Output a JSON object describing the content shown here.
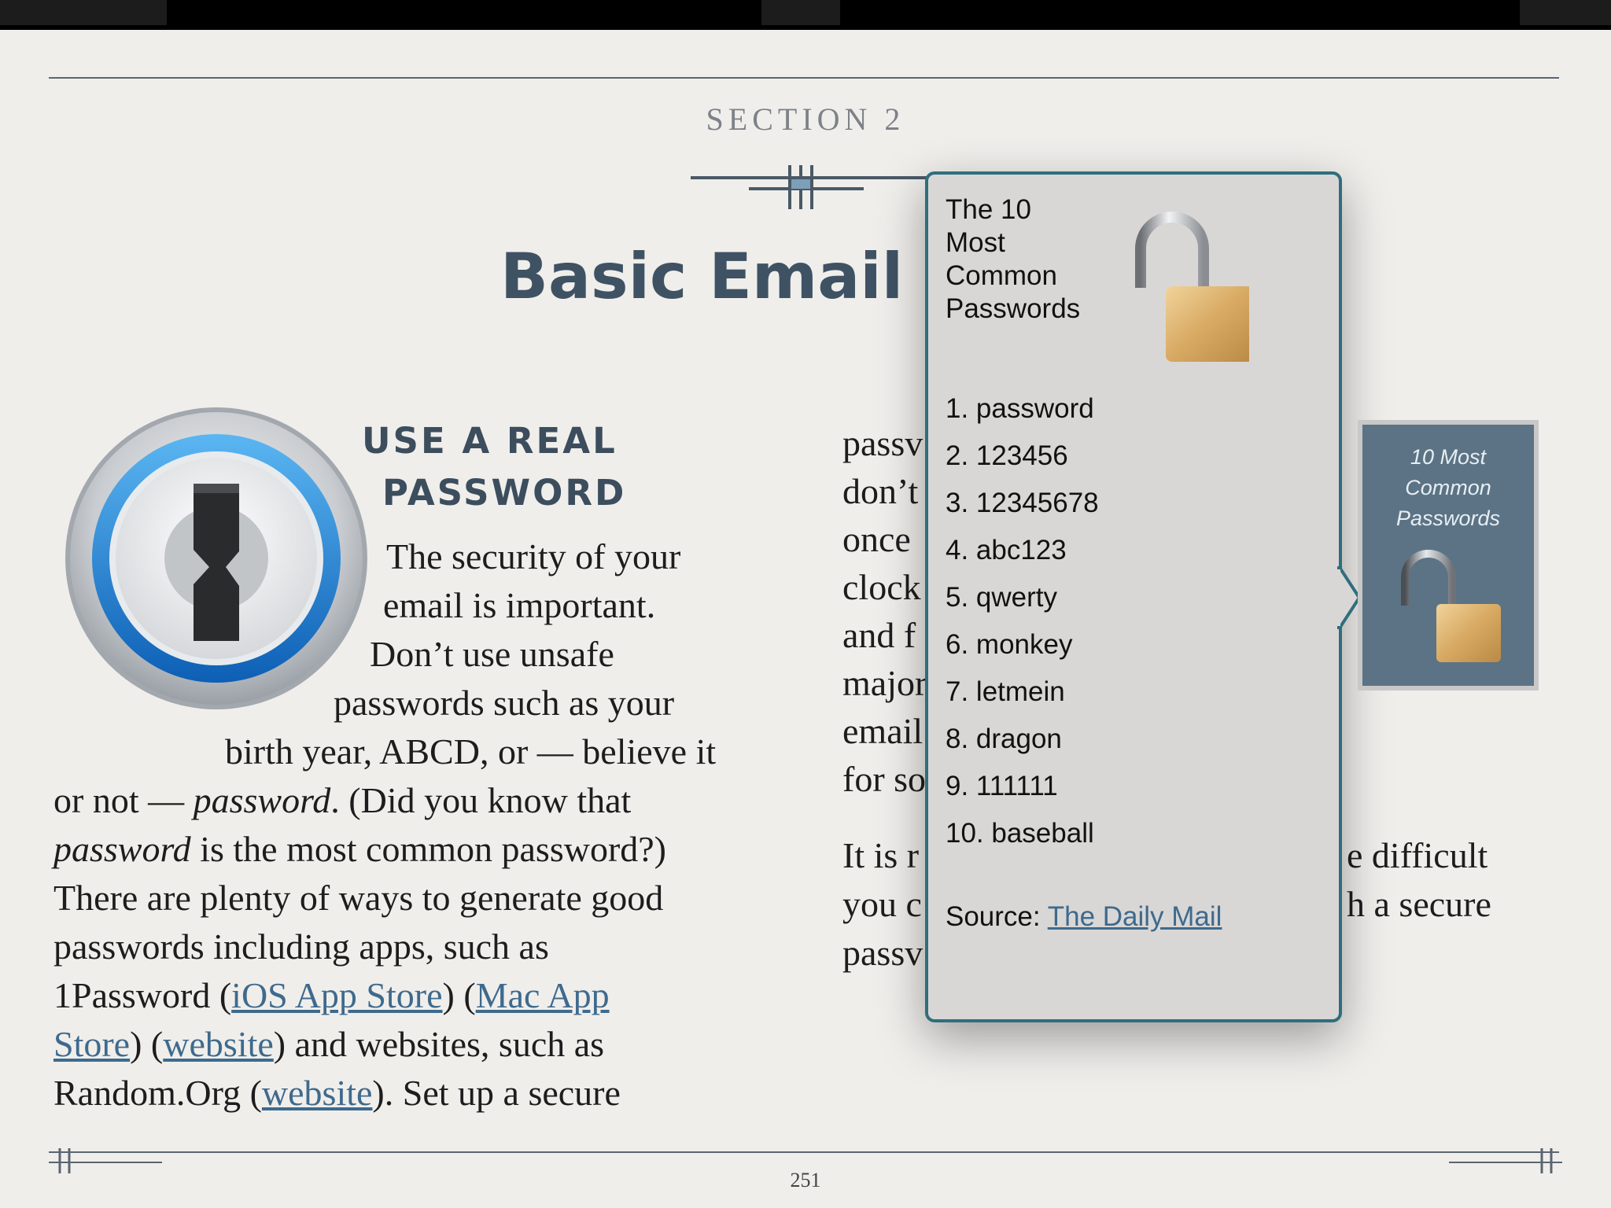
{
  "section": {
    "label": "SECTION 2"
  },
  "page": {
    "title": "Basic Email Se",
    "number": "251"
  },
  "aside": {
    "heading_line1": "USE A REAL",
    "heading_line2": "PASSWORD",
    "app_icon": "1password-keyhole-icon"
  },
  "body": {
    "line1": "The security of your",
    "line2": "email is important.",
    "line3": "Don’t use unsafe",
    "line4": "passwords such as your",
    "line5": "birth year, ABCD, or — believe it",
    "line6_a": "or not — ",
    "line6_italic": "password",
    "line6_b": ". (Did you know that",
    "line7_italic": "password",
    "line7_b": " is the most common password?)",
    "line8": "There are plenty of ways to generate good",
    "line9": "passwords including apps, such as",
    "line10_a": "1Password (",
    "link_ios": "iOS App Store",
    "line10_b": ") (",
    "link_mac_1": "Mac App",
    "link_mac_2": "Store",
    "line11_b": ") (",
    "link_website_1": "website",
    "line11_c": ") and websites, such as",
    "line12_a": "Random.Org (",
    "link_website_2": "website",
    "line12_b": "). Set up a secure"
  },
  "right_column": {
    "lines": [
      "passv",
      "don’t",
      "once",
      "clock",
      "and f",
      "major",
      "email",
      "for so"
    ],
    "p2_line1_left": "It is r",
    "p2_line1_right": "e difficult",
    "p2_line2_left": "you c",
    "p2_line2_right": "h a secure",
    "p2_line3_left": "passv"
  },
  "popup": {
    "title": "The  10\nMost\nCommon\nPasswords",
    "icon": "open-padlock-icon",
    "passwords": [
      "1. password",
      "2. 123456",
      "3. 12345678",
      "4. abc123",
      "5. qwerty",
      "6. monkey",
      "7. letmein",
      "8. dragon",
      "9. 111111",
      "10. baseball"
    ],
    "source_label": "Source: ",
    "source_link": "The Daily Mail"
  },
  "thumbnail": {
    "line1": "10 Most",
    "line2": "Common",
    "line3": "Passwords",
    "icon": "open-padlock-icon"
  },
  "colors": {
    "page_background": "#f0eeeb",
    "title": "#3f5264",
    "link": "#3e6a8d",
    "popup_border": "#2f6e7d",
    "popup_background": "#d9d7d6",
    "thumbnail_background": "#5b7385"
  }
}
